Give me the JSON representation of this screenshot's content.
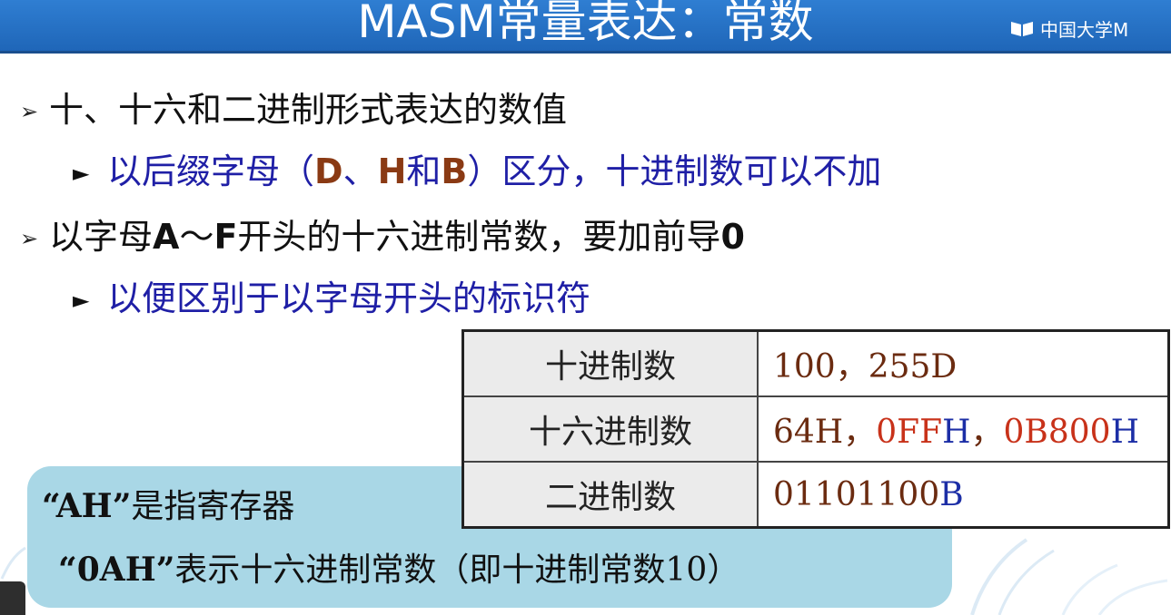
{
  "slide": {
    "title": "MASM常量表达：常数",
    "logo_text": "中国大学M"
  },
  "bullets": [
    {
      "level": 1,
      "marker": "➢",
      "runs": [
        {
          "text": "十、十六和二进制形式表达的数值",
          "style": "normal"
        }
      ]
    },
    {
      "level": 2,
      "marker": "►",
      "runs": [
        {
          "text": "以后缀字母（",
          "style": "normal"
        },
        {
          "text": "D",
          "style": "brown-bold"
        },
        {
          "text": "、",
          "style": "normal"
        },
        {
          "text": "H",
          "style": "brown-bold"
        },
        {
          "text": "和",
          "style": "normal"
        },
        {
          "text": "B",
          "style": "brown-bold"
        },
        {
          "text": "）区分，十进制数可以不加",
          "style": "normal"
        }
      ]
    },
    {
      "level": 1,
      "marker": "➢",
      "runs": [
        {
          "text": "以字母",
          "style": "normal"
        },
        {
          "text": "A",
          "style": "bold"
        },
        {
          "text": "～",
          "style": "normal"
        },
        {
          "text": "F",
          "style": "bold"
        },
        {
          "text": "开头的十六进制常数，要加前导",
          "style": "normal"
        },
        {
          "text": "0",
          "style": "bold"
        }
      ]
    },
    {
      "level": 2,
      "marker": "►",
      "runs": [
        {
          "text": "以便区别于以字母开头的标识符",
          "style": "normal"
        }
      ]
    }
  ],
  "table": {
    "rows": [
      {
        "label": "十进制数",
        "values": [
          {
            "text": "100，255D",
            "color": "brown"
          }
        ]
      },
      {
        "label": "十六进制数",
        "values": [
          {
            "text": "64H，",
            "color": "brown"
          },
          {
            "text": "0FF",
            "color": "red"
          },
          {
            "text": "H",
            "color": "blue"
          },
          {
            "text": "，",
            "color": "brown"
          },
          {
            "text": "0B800",
            "color": "red"
          },
          {
            "text": "H",
            "color": "blue"
          }
        ]
      },
      {
        "label": "二进制数",
        "values": [
          {
            "text": "01101100",
            "color": "brown"
          },
          {
            "text": "B",
            "color": "blue"
          }
        ]
      }
    ]
  },
  "note": {
    "line1_quoted": "“AH”",
    "line1_rest": "是指寄存器",
    "line2_quoted": "“0AH”",
    "line2_rest": "表示十六进制常数（即十进制常数10）"
  },
  "colors": {
    "title_bar": "#1f66b8",
    "bullet_level2": "#1f1fa6",
    "suffix_letters": "#8a3a14",
    "note_box": "#a9d7e6",
    "hex_digits": "#c8321a",
    "radix_suffix": "#1c2ea6"
  }
}
